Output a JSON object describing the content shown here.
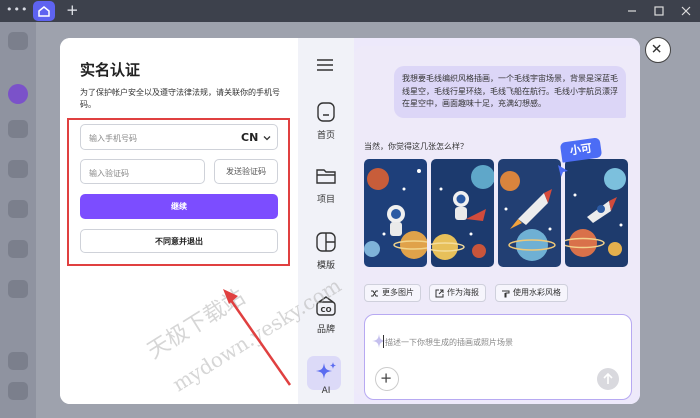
{
  "topbar": {
    "menu": "•••",
    "new_tab": "+"
  },
  "auth": {
    "title": "实名认证",
    "description": "为了保护帐户安全以及遵守法律法规，请关联你的手机号码。",
    "phone_placeholder": "输入手机号码",
    "country_code": "CN",
    "code_placeholder": "输入验证码",
    "send_code": "发送验证码",
    "continue": "继续",
    "disagree_exit": "不同意并退出"
  },
  "nav": {
    "items": [
      {
        "label": "首页",
        "icon": "home-icon"
      },
      {
        "label": "项目",
        "icon": "folder-icon"
      },
      {
        "label": "模版",
        "icon": "template-icon"
      },
      {
        "label": "品牌",
        "icon": "brand-icon"
      },
      {
        "label": "AI",
        "icon": "ai-sparkle-icon"
      }
    ]
  },
  "chat": {
    "user_message": "我想要毛线编织风格插画，一个毛线宇宙场景，背景是深蓝毛线星空，毛线行星环绕，毛线飞船在航行。毛线小宇航员漂浮在星空中，画面趣味十足，充满幻想感。",
    "assistant_reply": "当然，你觉得这几张怎么样？",
    "assistant_tag": "小可",
    "actions": [
      "更多图片",
      "作为海报",
      "使用水彩风格"
    ],
    "composer_placeholder": "描述一下你想生成的插画或照片场景"
  },
  "watermark": {
    "line1": "天极下载站",
    "line2": "mydown.yesky.com"
  },
  "colors": {
    "accent": "#7c4dff",
    "highlight_box": "#e04040",
    "tag": "#4c6cf5"
  }
}
